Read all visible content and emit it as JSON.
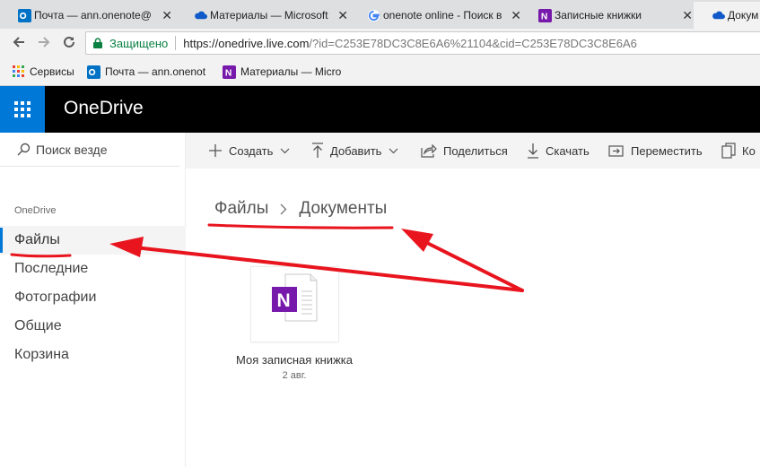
{
  "browser": {
    "tabs": [
      {
        "title": "Почта — ann.onenote@",
        "icon": "outlook-icon",
        "active": false
      },
      {
        "title": "Материалы — Microsoft",
        "icon": "onedrive-cloud-icon",
        "active": false
      },
      {
        "title": "onenote online - Поиск в",
        "icon": "google-icon",
        "active": false
      },
      {
        "title": "Записные книжки",
        "icon": "onenote-icon",
        "active": false
      },
      {
        "title": "Докум",
        "icon": "onedrive-cloud-icon",
        "active": true
      }
    ],
    "address": {
      "secure_label": "Защищено",
      "url_host": "https://onedrive.live.com",
      "url_rest": "/?id=C253E78DC3C8E6A6%21104&cid=C253E78DC3C8E6A6"
    },
    "bookmarks": [
      {
        "label": "Сервисы",
        "icon": "apps-grid-icon"
      },
      {
        "label": "Почта — ann.onenot",
        "icon": "outlook-icon"
      },
      {
        "label": "Материалы — Micro",
        "icon": "onenote-icon"
      }
    ]
  },
  "app": {
    "title": "OneDrive"
  },
  "sidebar": {
    "search_placeholder": "Поиск везде",
    "section_label": "OneDrive",
    "items": [
      {
        "label": "Файлы",
        "active": true
      },
      {
        "label": "Последние",
        "active": false
      },
      {
        "label": "Фотографии",
        "active": false
      },
      {
        "label": "Общие",
        "active": false
      },
      {
        "label": "Корзина",
        "active": false
      }
    ]
  },
  "commands": [
    {
      "label": "Создать",
      "icon": "plus-icon",
      "dropdown": true
    },
    {
      "label": "Добавить",
      "icon": "upload-arrow-icon",
      "dropdown": true
    },
    {
      "label": "Поделиться",
      "icon": "share-icon",
      "dropdown": false
    },
    {
      "label": "Скачать",
      "icon": "download-arrow-icon",
      "dropdown": false
    },
    {
      "label": "Переместить",
      "icon": "move-to-icon",
      "dropdown": false
    },
    {
      "label": "Ко",
      "icon": "copy-icon",
      "dropdown": false
    }
  ],
  "breadcrumb": {
    "root": "Файлы",
    "current": "Документы"
  },
  "files": [
    {
      "name": "Моя записная книжка",
      "date": "2 авг.",
      "type": "onenote-notebook"
    }
  ],
  "colors": {
    "onedrive_blue": "#0078d7",
    "onenote_purple": "#7719aa",
    "annotation_red": "#e8141e",
    "secure_green": "#0b8043"
  }
}
